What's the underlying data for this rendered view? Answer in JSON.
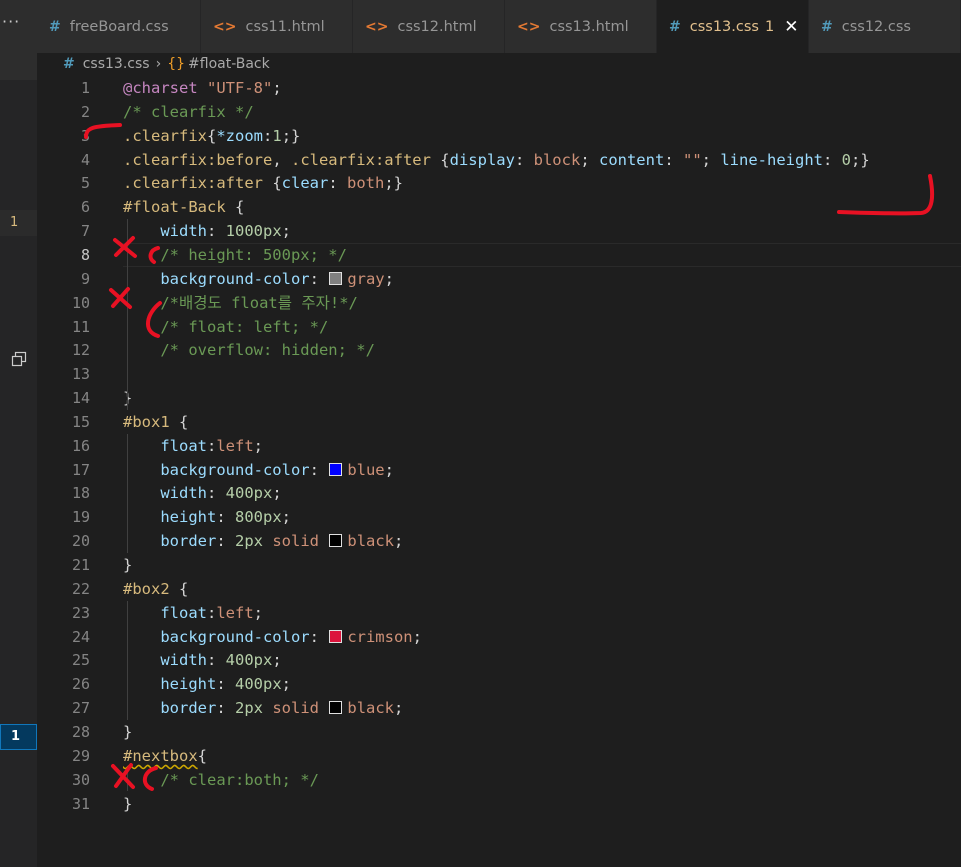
{
  "sidebar": {
    "dots": "···",
    "badge_top": "1",
    "badge_bottom": "1"
  },
  "tabs": [
    {
      "label": "freeBoard.css",
      "icon": "#",
      "kind": "css",
      "active": false
    },
    {
      "label": "css11.html",
      "icon": "<>",
      "kind": "html",
      "active": false
    },
    {
      "label": "css12.html",
      "icon": "<>",
      "kind": "html",
      "active": false
    },
    {
      "label": "css13.html",
      "icon": "<>",
      "kind": "html",
      "active": false
    },
    {
      "label": "css13.css",
      "icon": "#",
      "kind": "css",
      "active": true,
      "problems": "1",
      "close": "✕"
    },
    {
      "label": "css12.css",
      "icon": "#",
      "kind": "css",
      "active": false
    }
  ],
  "breadcrumb": {
    "file_icon": "#",
    "file": "css13.css",
    "separator": "›",
    "symbol_icon": "{}",
    "symbol": "#float-Back"
  },
  "editor": {
    "current_line": 8,
    "lines": [
      {
        "n": "1",
        "tokens": [
          [
            "t-at",
            "@charset"
          ],
          [
            "t-pun",
            " "
          ],
          [
            "t-str",
            "\"UTF-8\""
          ],
          [
            "t-pun",
            ";"
          ]
        ]
      },
      {
        "n": "2",
        "tokens": [
          [
            "t-com",
            "/* clearfix */"
          ]
        ]
      },
      {
        "n": "3",
        "tokens": [
          [
            "t-sel",
            ".clearfix"
          ],
          [
            "t-pun",
            "{"
          ],
          [
            "t-prop",
            "*zoom"
          ],
          [
            "t-pun",
            ":"
          ],
          [
            "t-num",
            "1"
          ],
          [
            "t-pun",
            ";}"
          ]
        ]
      },
      {
        "n": "4",
        "tokens": [
          [
            "t-sel",
            ".clearfix:before"
          ],
          [
            "t-pun",
            ", "
          ],
          [
            "t-sel",
            ".clearfix:after"
          ],
          [
            "t-pun",
            " {"
          ],
          [
            "t-prop",
            "display"
          ],
          [
            "t-pun",
            ": "
          ],
          [
            "t-kw",
            "block"
          ],
          [
            "t-pun",
            "; "
          ],
          [
            "t-prop",
            "content"
          ],
          [
            "t-pun",
            ": "
          ],
          [
            "t-str",
            "\"\""
          ],
          [
            "t-pun",
            "; "
          ],
          [
            "t-prop",
            "line-height"
          ],
          [
            "t-pun",
            ": "
          ],
          [
            "t-num",
            "0"
          ],
          [
            "t-pun",
            ";}"
          ]
        ]
      },
      {
        "n": "5",
        "tokens": [
          [
            "t-sel",
            ".clearfix:after"
          ],
          [
            "t-pun",
            " {"
          ],
          [
            "t-prop",
            "clear"
          ],
          [
            "t-pun",
            ": "
          ],
          [
            "t-kw",
            "both"
          ],
          [
            "t-pun",
            ";}"
          ]
        ]
      },
      {
        "n": "6",
        "tokens": [
          [
            "t-sel",
            "#float-Back"
          ],
          [
            "t-pun",
            " {"
          ]
        ]
      },
      {
        "n": "7",
        "tokens": [
          [
            "t-pun",
            "    "
          ],
          [
            "t-prop",
            "width"
          ],
          [
            "t-pun",
            ": "
          ],
          [
            "t-num",
            "1000px"
          ],
          [
            "t-pun",
            ";"
          ]
        ]
      },
      {
        "n": "8",
        "tokens": [
          [
            "t-pun",
            "    "
          ],
          [
            "t-com",
            "/* height: 500px; */"
          ]
        ]
      },
      {
        "n": "9",
        "tokens": [
          [
            "t-pun",
            "    "
          ],
          [
            "t-prop",
            "background-color"
          ],
          [
            "t-pun",
            ": "
          ],
          [
            "swatch",
            "#808080"
          ],
          [
            "t-kw",
            "gray"
          ],
          [
            "t-pun",
            ";"
          ]
        ]
      },
      {
        "n": "10",
        "tokens": [
          [
            "t-pun",
            "    "
          ],
          [
            "t-com",
            "/*배경도 float를 주자!*/"
          ]
        ]
      },
      {
        "n": "11",
        "tokens": [
          [
            "t-pun",
            "    "
          ],
          [
            "t-com",
            "/* float: left; */"
          ]
        ]
      },
      {
        "n": "12",
        "tokens": [
          [
            "t-pun",
            "    "
          ],
          [
            "t-com",
            "/* overflow: hidden; */"
          ]
        ]
      },
      {
        "n": "13",
        "tokens": []
      },
      {
        "n": "14",
        "tokens": [
          [
            "t-pun",
            "}"
          ]
        ]
      },
      {
        "n": "15",
        "tokens": [
          [
            "t-sel",
            "#box1"
          ],
          [
            "t-pun",
            " {"
          ]
        ]
      },
      {
        "n": "16",
        "tokens": [
          [
            "t-pun",
            "    "
          ],
          [
            "t-prop",
            "float"
          ],
          [
            "t-pun",
            ":"
          ],
          [
            "t-kw",
            "left"
          ],
          [
            "t-pun",
            ";"
          ]
        ]
      },
      {
        "n": "17",
        "tokens": [
          [
            "t-pun",
            "    "
          ],
          [
            "t-prop",
            "background-color"
          ],
          [
            "t-pun",
            ": "
          ],
          [
            "swatch",
            "#0000ff"
          ],
          [
            "t-kw",
            "blue"
          ],
          [
            "t-pun",
            ";"
          ]
        ]
      },
      {
        "n": "18",
        "tokens": [
          [
            "t-pun",
            "    "
          ],
          [
            "t-prop",
            "width"
          ],
          [
            "t-pun",
            ": "
          ],
          [
            "t-num",
            "400px"
          ],
          [
            "t-pun",
            ";"
          ]
        ]
      },
      {
        "n": "19",
        "tokens": [
          [
            "t-pun",
            "    "
          ],
          [
            "t-prop",
            "height"
          ],
          [
            "t-pun",
            ": "
          ],
          [
            "t-num",
            "800px"
          ],
          [
            "t-pun",
            ";"
          ]
        ]
      },
      {
        "n": "20",
        "tokens": [
          [
            "t-pun",
            "    "
          ],
          [
            "t-prop",
            "border"
          ],
          [
            "t-pun",
            ": "
          ],
          [
            "t-num",
            "2px"
          ],
          [
            "t-pun",
            " "
          ],
          [
            "t-kw",
            "solid"
          ],
          [
            "t-pun",
            " "
          ],
          [
            "swatch",
            "#000000"
          ],
          [
            "t-kw",
            "black"
          ],
          [
            "t-pun",
            ";"
          ]
        ]
      },
      {
        "n": "21",
        "tokens": [
          [
            "t-pun",
            "}"
          ]
        ]
      },
      {
        "n": "22",
        "tokens": [
          [
            "t-sel",
            "#box2"
          ],
          [
            "t-pun",
            " {"
          ]
        ]
      },
      {
        "n": "23",
        "tokens": [
          [
            "t-pun",
            "    "
          ],
          [
            "t-prop",
            "float"
          ],
          [
            "t-pun",
            ":"
          ],
          [
            "t-kw",
            "left"
          ],
          [
            "t-pun",
            ";"
          ]
        ]
      },
      {
        "n": "24",
        "tokens": [
          [
            "t-pun",
            "    "
          ],
          [
            "t-prop",
            "background-color"
          ],
          [
            "t-pun",
            ": "
          ],
          [
            "swatch",
            "#dc143c"
          ],
          [
            "t-kw",
            "crimson"
          ],
          [
            "t-pun",
            ";"
          ]
        ]
      },
      {
        "n": "25",
        "tokens": [
          [
            "t-pun",
            "    "
          ],
          [
            "t-prop",
            "width"
          ],
          [
            "t-pun",
            ": "
          ],
          [
            "t-num",
            "400px"
          ],
          [
            "t-pun",
            ";"
          ]
        ]
      },
      {
        "n": "26",
        "tokens": [
          [
            "t-pun",
            "    "
          ],
          [
            "t-prop",
            "height"
          ],
          [
            "t-pun",
            ": "
          ],
          [
            "t-num",
            "400px"
          ],
          [
            "t-pun",
            ";"
          ]
        ]
      },
      {
        "n": "27",
        "tokens": [
          [
            "t-pun",
            "    "
          ],
          [
            "t-prop",
            "border"
          ],
          [
            "t-pun",
            ": "
          ],
          [
            "t-num",
            "2px"
          ],
          [
            "t-pun",
            " "
          ],
          [
            "t-kw",
            "solid"
          ],
          [
            "t-pun",
            " "
          ],
          [
            "swatch",
            "#000000"
          ],
          [
            "t-kw",
            "black"
          ],
          [
            "t-pun",
            ";"
          ]
        ]
      },
      {
        "n": "28",
        "tokens": [
          [
            "t-pun",
            "}"
          ]
        ]
      },
      {
        "n": "29",
        "tokens": [
          [
            "t-sel t-warn",
            "#nextbox"
          ],
          [
            "t-pun",
            "{"
          ]
        ]
      },
      {
        "n": "30",
        "tokens": [
          [
            "t-pun",
            "    "
          ],
          [
            "t-com",
            "/* clear:both; */"
          ]
        ]
      },
      {
        "n": "31",
        "tokens": [
          [
            "t-pun",
            "}"
          ]
        ]
      }
    ]
  },
  "colors": {
    "annotation": "#e81123"
  }
}
